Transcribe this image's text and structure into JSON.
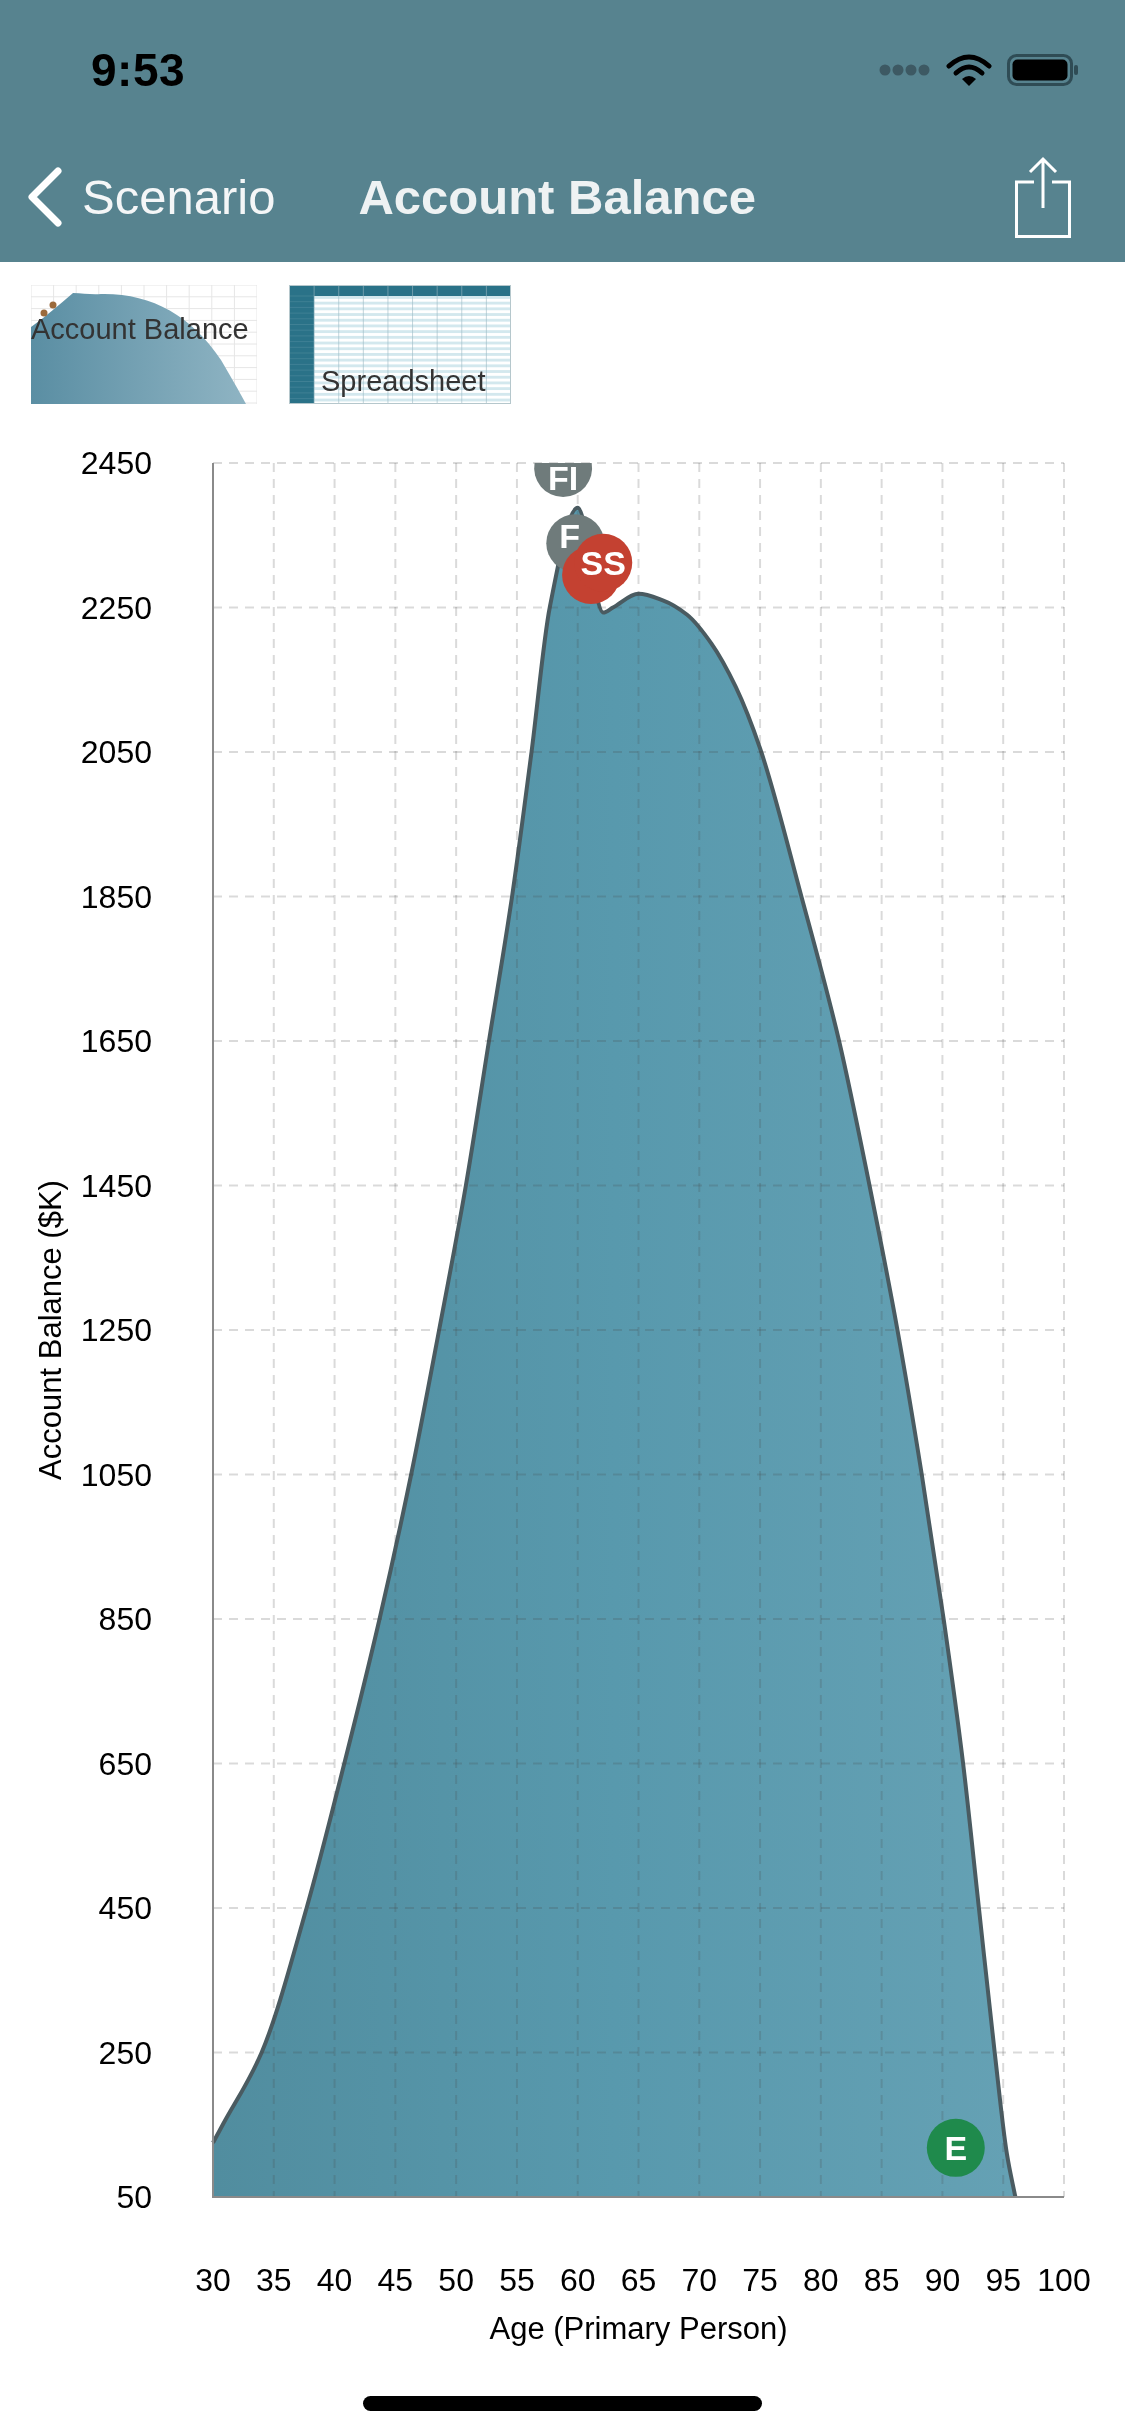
{
  "status_bar": {
    "time": "9:53"
  },
  "nav_bar": {
    "back_label": "Scenario",
    "title": "Account Balance"
  },
  "thumbnails": [
    {
      "kind": "chart",
      "label": "Account Balance"
    },
    {
      "kind": "spreadsheet",
      "label": "Spreadsheet"
    }
  ],
  "chart": {
    "chart_data": {
      "type": "area",
      "xlabel": "Age (Primary Person)",
      "ylabel": "Account Balance ($K)",
      "x": [
        30,
        30.8,
        34,
        37.7,
        40.8,
        43.7,
        46.3,
        48.6,
        50.8,
        52.7,
        54.6,
        56.2,
        57.7,
        60,
        62.1,
        62.9,
        65,
        67,
        69,
        71,
        73,
        75,
        78.4,
        81.5,
        84,
        86.3,
        88.3,
        90.1,
        91.7,
        93,
        94.3,
        95.3,
        96
      ],
      "series": [
        {
          "color": "#5899ad",
          "values": [
            125,
            150,
            250,
            450,
            650,
            850,
            1050,
            1250,
            1450,
            1650,
            1850,
            2050,
            2250,
            2388,
            2243,
            2250,
            2269,
            2260,
            2240,
            2200,
            2140,
            2055,
            1850,
            1650,
            1450,
            1250,
            1050,
            850,
            650,
            450,
            250,
            110,
            50
          ]
        }
      ],
      "xlim": [
        30,
        100
      ],
      "ylim": [
        50,
        2450
      ],
      "xticks": [
        30,
        35,
        40,
        45,
        50,
        55,
        60,
        65,
        70,
        75,
        80,
        85,
        90,
        95,
        100
      ],
      "yticks": [
        50,
        250,
        450,
        650,
        850,
        1050,
        1250,
        1450,
        1650,
        1850,
        2050,
        2250,
        2450
      ],
      "grid": true
    },
    "markers": [
      {
        "text": "FI",
        "color": "#6f7b7b"
      },
      {
        "text": "F",
        "color": "#6f7b7b"
      },
      {
        "color": "#c44131"
      },
      {
        "text": "SS",
        "color": "#c44131"
      },
      {
        "text": "E",
        "color": "#1f8a4c"
      }
    ]
  }
}
